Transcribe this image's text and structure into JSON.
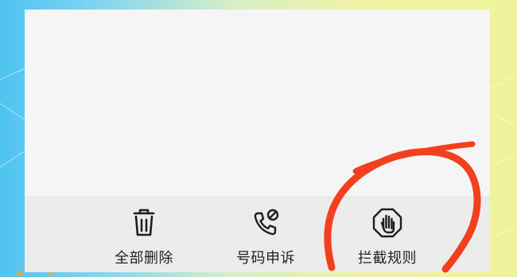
{
  "toolbar": {
    "items": [
      {
        "label": "全部删除",
        "icon": "trash-icon"
      },
      {
        "label": "号码申诉",
        "icon": "phone-block-icon"
      },
      {
        "label": "拦截规则",
        "icon": "hand-stop-icon"
      }
    ]
  },
  "colors": {
    "panel": "#f5f5f5",
    "toolbar": "#ececec",
    "text": "#222222",
    "annotation": "#f2401f"
  }
}
